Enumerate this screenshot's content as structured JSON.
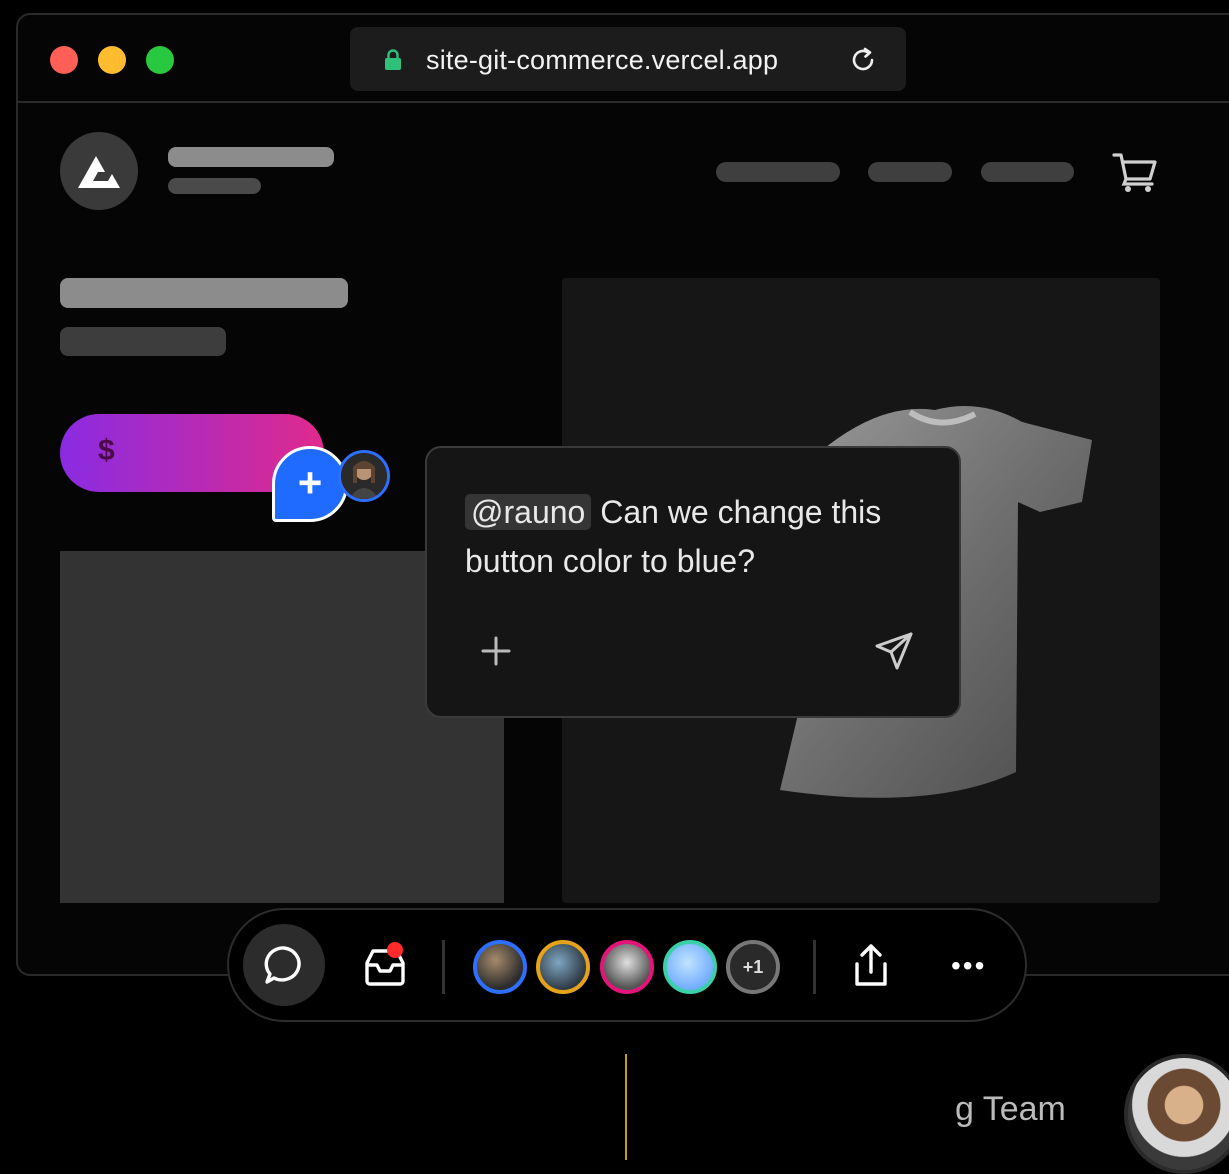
{
  "browser": {
    "url": "site-git-commerce.vercel.app"
  },
  "product_page": {
    "buy_button_label": "$"
  },
  "comment": {
    "mention": "@rauno",
    "text": " Can we change this button color to blue?"
  },
  "toolbar": {
    "overflow_count": "+1",
    "more_label": "•••"
  },
  "footer": {
    "team_text": "g Team"
  },
  "colors": {
    "accent_blue": "#1f6bff",
    "buy_gradient_start": "#8a2be2",
    "buy_gradient_end": "#e02a8c",
    "notification_red": "#ff2a2a"
  }
}
